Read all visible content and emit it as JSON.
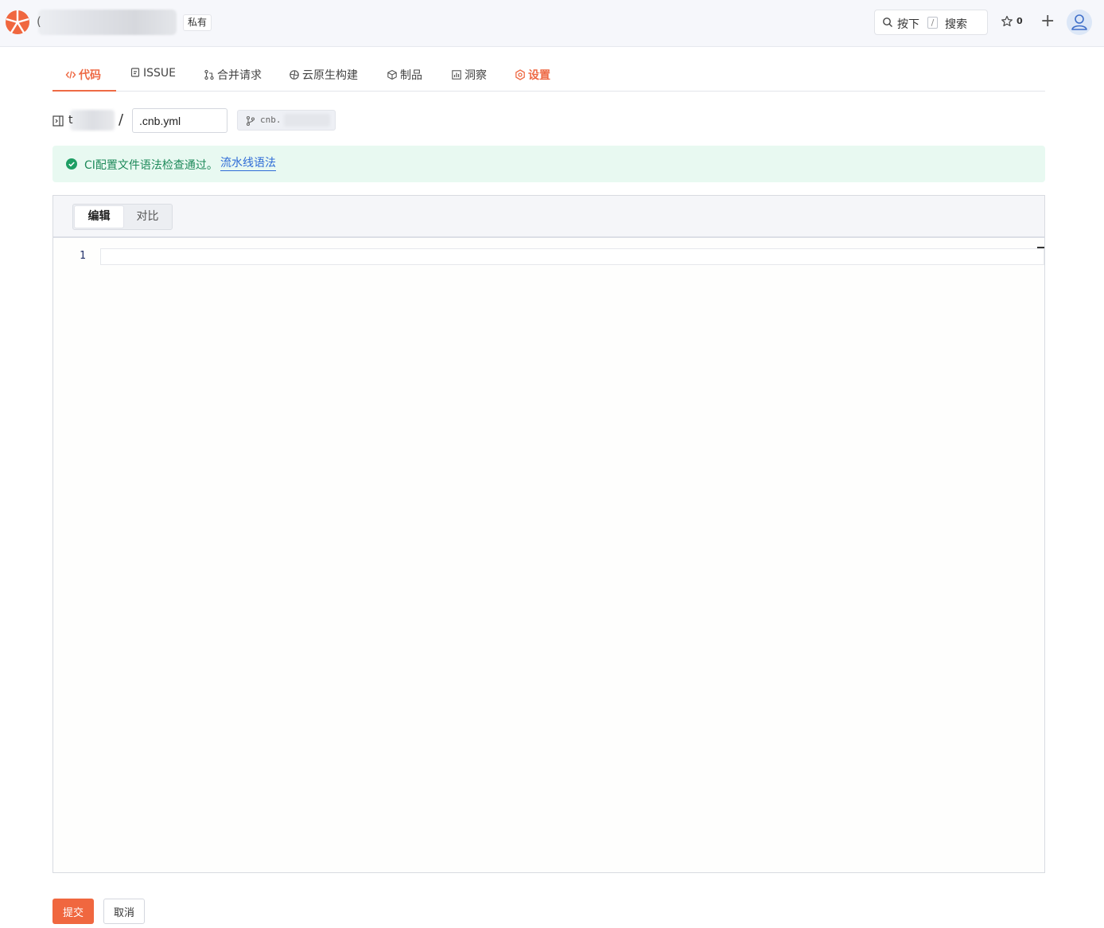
{
  "header": {
    "repo_prefix": "(",
    "visibility_badge": "私有",
    "search": {
      "label_press": "按下",
      "shortcut_key": "/",
      "label_search": "搜索"
    },
    "star_count": "0",
    "brand_color": "#f0673f"
  },
  "nav": {
    "tabs": [
      {
        "label": "代码",
        "icon": "code-icon",
        "active": true
      },
      {
        "label": "ISSUE",
        "icon": "issue-icon"
      },
      {
        "label": "合并请求",
        "icon": "merge-request-icon"
      },
      {
        "label": "云原生构建",
        "icon": "build-icon"
      },
      {
        "label": "制品",
        "icon": "package-icon"
      },
      {
        "label": "洞察",
        "icon": "insights-icon"
      },
      {
        "label": "设置",
        "icon": "settings-icon",
        "highlighted": true
      }
    ]
  },
  "path": {
    "repo_start": "t",
    "separator": "/",
    "filename": ".cnb.yml",
    "branch_prefix": "cnb."
  },
  "alert": {
    "message": "CI配置文件语法检查通过。",
    "link_text": "流水线语法",
    "status_color": "#1e8a5a"
  },
  "editor": {
    "tabs": {
      "edit": "编辑",
      "diff": "对比"
    },
    "line_numbers": [
      "1"
    ]
  },
  "actions": {
    "submit_label": "提交",
    "cancel_label": "取消"
  }
}
